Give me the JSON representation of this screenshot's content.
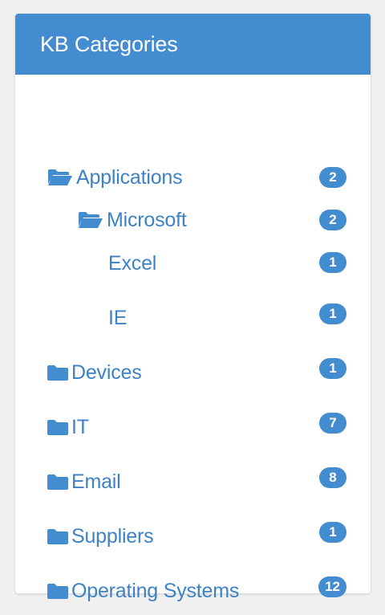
{
  "panel": {
    "title": "KB Categories"
  },
  "colors": {
    "header_bg": "#438ccf",
    "link": "#3d82c4",
    "badge_bg": "#438ccf",
    "page_bg": "#f0f0f0"
  },
  "categories": [
    {
      "label": "Applications",
      "count": "2",
      "icon": "folder-open-icon",
      "level": 0
    },
    {
      "label": "Microsoft",
      "count": "2",
      "icon": "folder-open-icon",
      "level": 1
    },
    {
      "label": "Excel",
      "count": "1",
      "icon": "none",
      "level": 2
    },
    {
      "label": "IE",
      "count": "1",
      "icon": "none",
      "level": 2
    },
    {
      "label": "Devices",
      "count": "1",
      "icon": "folder-icon",
      "level": 0
    },
    {
      "label": "IT",
      "count": "7",
      "icon": "folder-icon",
      "level": 0
    },
    {
      "label": "Email",
      "count": "8",
      "icon": "folder-icon",
      "level": 0
    },
    {
      "label": "Suppliers",
      "count": "1",
      "icon": "folder-icon",
      "level": 0
    },
    {
      "label": "Operating Systems",
      "count": "12",
      "icon": "folder-icon",
      "level": 0
    }
  ]
}
